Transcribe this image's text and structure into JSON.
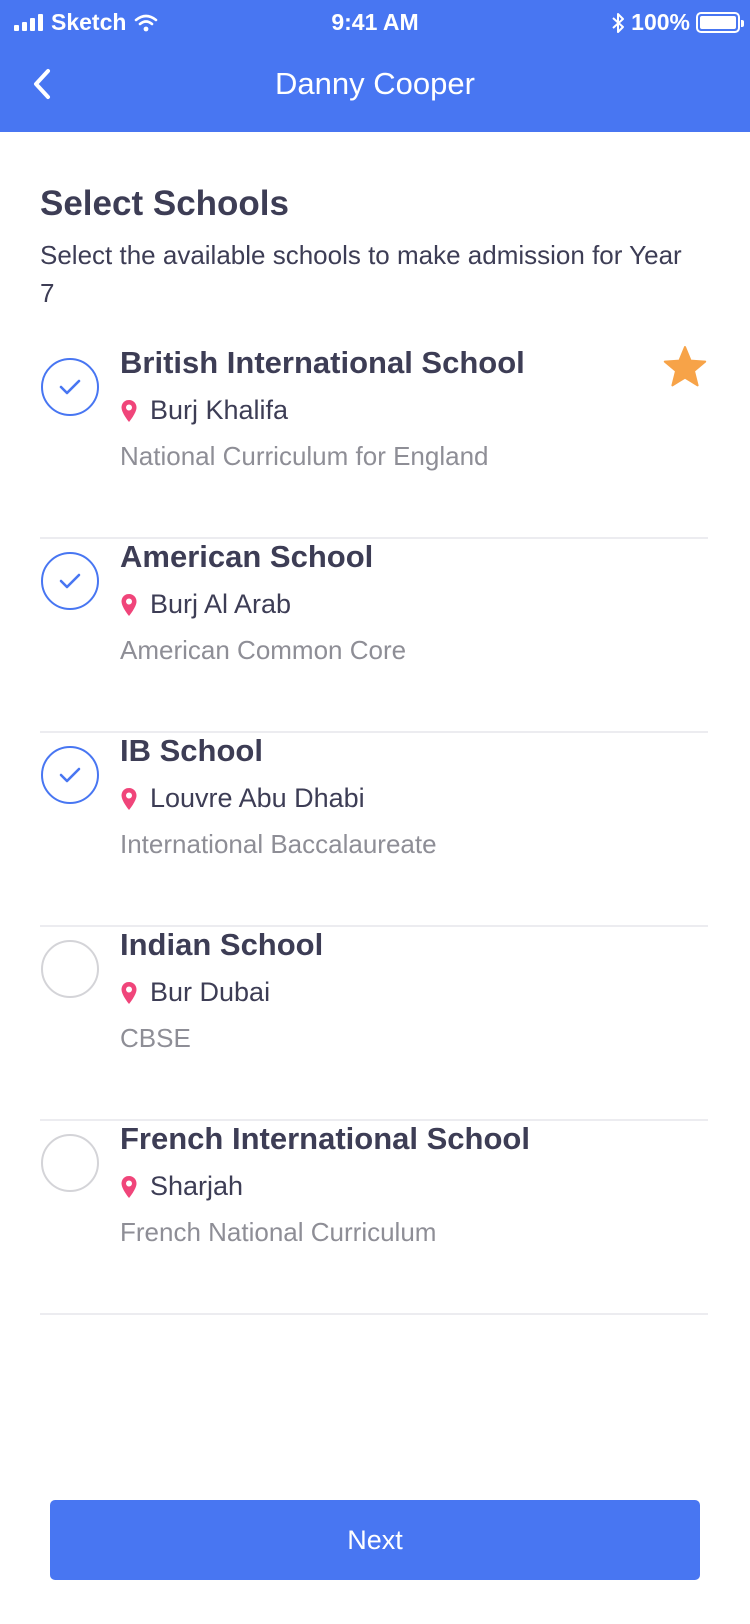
{
  "status_bar": {
    "carrier": "Sketch",
    "time": "9:41 AM",
    "battery": "100%"
  },
  "nav": {
    "title": "Danny Cooper",
    "back_icon": "chevron-left-icon"
  },
  "section": {
    "title": "Select Schools",
    "subtitle": "Select the available schools to make admission for Year 7"
  },
  "schools": [
    {
      "name": "British International School",
      "location": "Burj Khalifa",
      "curriculum": "National Curriculum for England",
      "selected": true,
      "favorite": true
    },
    {
      "name": "American School",
      "location": "Burj Al Arab",
      "curriculum": "American Common Core",
      "selected": true,
      "favorite": false
    },
    {
      "name": "IB School",
      "location": "Louvre Abu Dhabi",
      "curriculum": "International Baccalaureate",
      "selected": true,
      "favorite": false
    },
    {
      "name": "Indian School",
      "location": "Bur Dubai",
      "curriculum": "CBSE",
      "selected": false,
      "favorite": false
    },
    {
      "name": "French International School",
      "location": "Sharjah",
      "curriculum": "French National Curriculum",
      "selected": false,
      "favorite": false
    }
  ],
  "next_button": {
    "label": "Next"
  },
  "colors": {
    "accent": "#4876f2",
    "pin": "#f0457a",
    "star": "#f7a348",
    "text": "#3d3d55",
    "muted": "#8e8e96"
  }
}
